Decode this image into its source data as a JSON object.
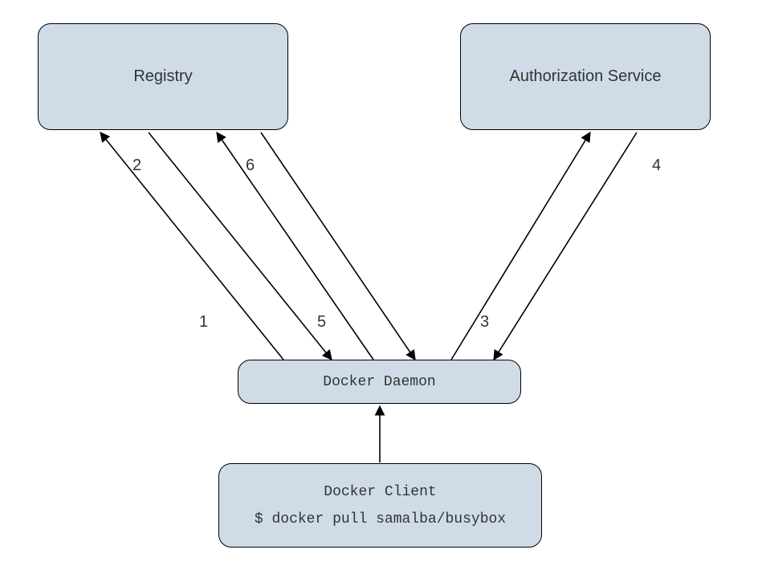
{
  "boxes": {
    "registry": {
      "label": "Registry"
    },
    "auth": {
      "label": "Authorization Service"
    },
    "daemon": {
      "label": "Docker Daemon"
    },
    "client": {
      "line1": "Docker Client",
      "line2": "$ docker pull samalba/busybox"
    }
  },
  "labels": {
    "l1": "1",
    "l2": "2",
    "l3": "3",
    "l4": "4",
    "l5": "5",
    "l6": "6"
  },
  "colors": {
    "boxFill": "#cfdce8",
    "stroke": "#000000"
  }
}
